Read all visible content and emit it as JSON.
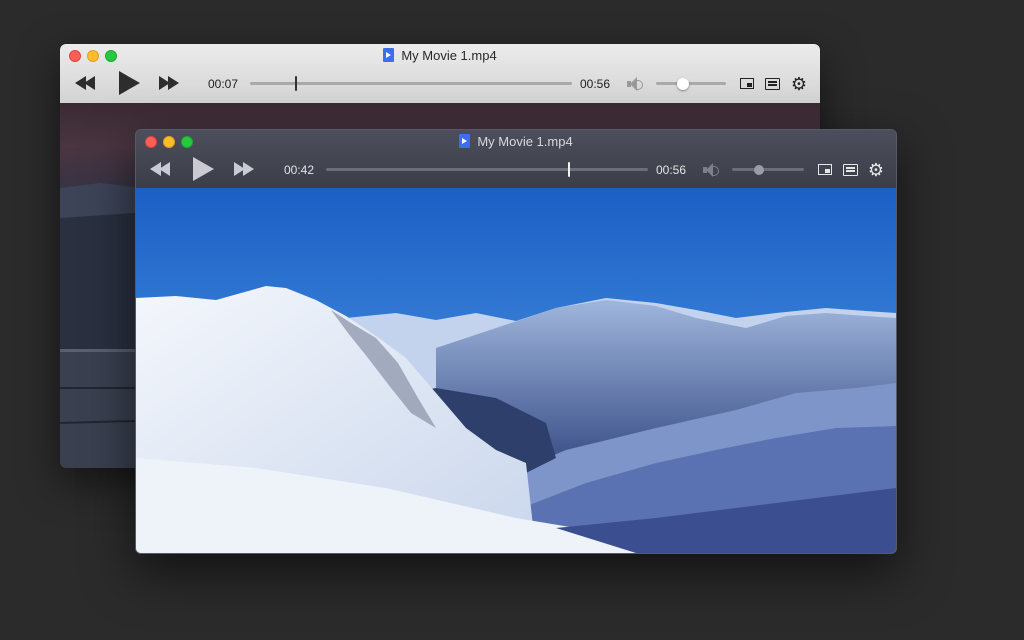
{
  "back_window": {
    "title": "My Movie 1.mp4",
    "elapsed": "00:07",
    "duration": "00:56",
    "progress": 0.14,
    "volume": 0.38
  },
  "front_window": {
    "title": "My Movie 1.mp4",
    "elapsed": "00:42",
    "duration": "00:56",
    "progress": 0.75,
    "volume": 0.38
  },
  "icons": {
    "file": "movie-file-icon",
    "seek_back": "rewind-icon",
    "play": "play-icon",
    "seek_forward": "fast-forward-icon",
    "volume": "speaker-icon",
    "pip": "picture-in-picture-icon",
    "playlist": "playlist-icon",
    "settings": "gear-icon"
  },
  "colors": {
    "close": "#fe5f57",
    "minimize": "#febc2e",
    "zoom": "#28c840",
    "file_icon": "#3c6ef0",
    "sky_top": "#1d64c8",
    "sky_bottom": "#5aa3ec"
  }
}
